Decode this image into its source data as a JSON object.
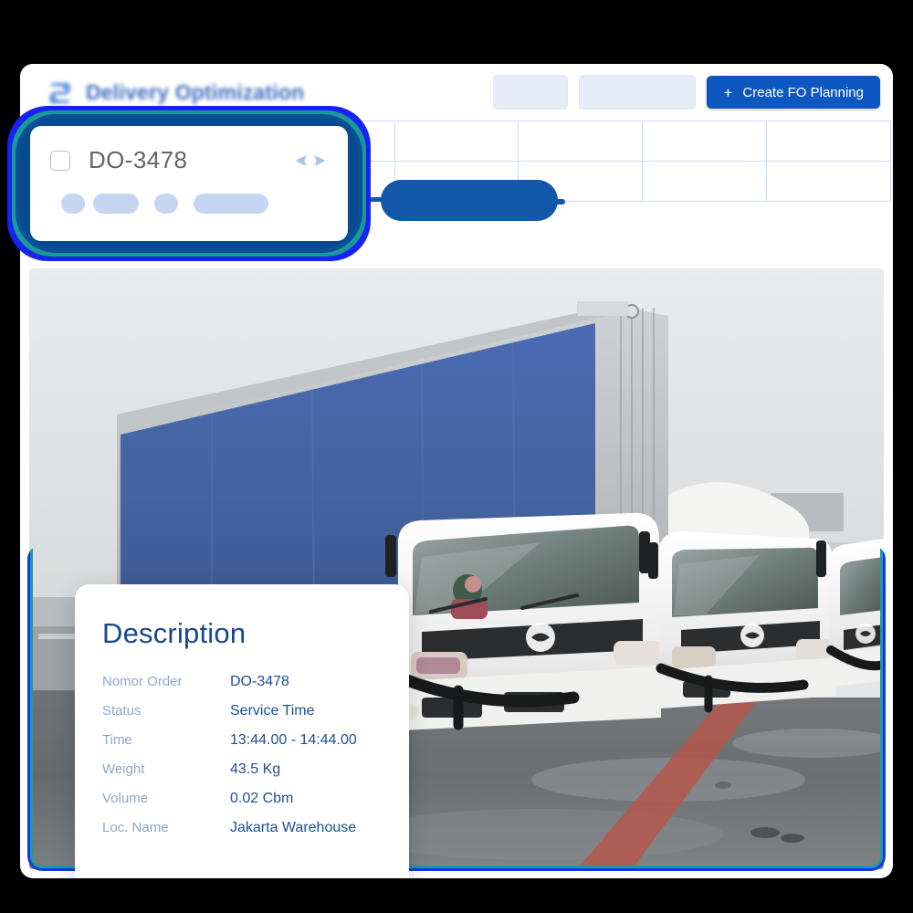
{
  "header": {
    "title": "Delivery Optimization",
    "logo_icon": "logistics-logo-icon",
    "filter_field_value": "",
    "search_field_value": "",
    "create_button_label": "Create FO Planning",
    "create_button_plus": "+",
    "accent_color": "#0f57c0"
  },
  "table": {
    "headers": [
      "",
      "",
      "",
      "",
      "",
      "",
      ""
    ],
    "rows": [
      [
        "",
        "",
        "",
        "",
        "",
        "",
        ""
      ],
      [
        "",
        "",
        "",
        "",
        "",
        "",
        ""
      ]
    ],
    "redacted": true,
    "redaction_color": "#1358a8",
    "grid_line_color": "#cfdcf3"
  },
  "focus_modal": {
    "checkbox_checked": false,
    "order_number": "DO-3478",
    "eye_icon": "eye-icon",
    "glow_colors": [
      "#1822f2",
      "#199a96",
      "#0a4f9a",
      "#084a8f"
    ],
    "placeholder_pills": 4
  },
  "photo": {
    "alt": "Three white Hino box trucks parked on wet asphalt, blue curtain-side trailer in foreground",
    "rim_color": "#1038e8",
    "rim_accent": "#1b9aa8"
  },
  "description": {
    "title": "Description",
    "label_color": "#8ea7c6",
    "value_color": "#1b4f95",
    "rows": [
      {
        "label": "Nomor Order",
        "value": "DO-3478"
      },
      {
        "label": "Status",
        "value": "Service Time"
      },
      {
        "label": "Time",
        "value": "13:44.00 - 14:44.00"
      },
      {
        "label": "Weight",
        "value": "43.5 Kg"
      },
      {
        "label": "Volume",
        "value": "0.02 Cbm"
      },
      {
        "label": "Loc. Name",
        "value": "Jakarta Warehouse"
      }
    ]
  }
}
